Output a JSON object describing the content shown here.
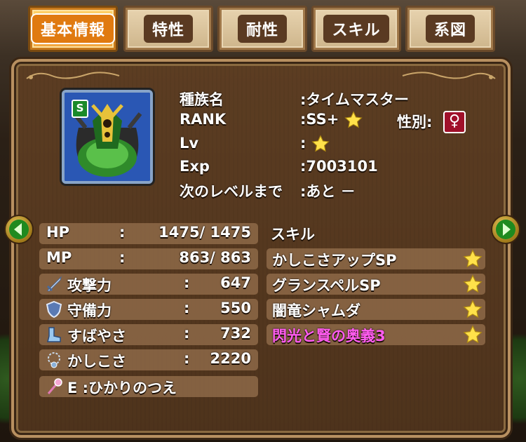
{
  "tabs": [
    {
      "label": "基本情報",
      "active": true
    },
    {
      "label": "特性",
      "active": false
    },
    {
      "label": "耐性",
      "active": false
    },
    {
      "label": "スキル",
      "active": false
    },
    {
      "label": "系図",
      "active": false
    }
  ],
  "monster": {
    "rank_badge": "S",
    "info": [
      {
        "label": "種族名",
        "value": ":タイムマスター"
      },
      {
        "label": "RANK",
        "value": ":SS+"
      },
      {
        "label": "Lv",
        "value": ":"
      },
      {
        "label": "Exp",
        "value": ":7003101"
      },
      {
        "label": "次のレベルまで",
        "value": ":あと －"
      }
    ],
    "gender_label": "性別:",
    "gender_symbol": "♀"
  },
  "stats": [
    {
      "label": "HP",
      "sep": ":",
      "value": "1475/ 1475",
      "icon": "none"
    },
    {
      "label": "MP",
      "sep": ":",
      "value": "863/   863",
      "icon": "none"
    },
    {
      "label": "攻撃力",
      "sep": ":",
      "value": "647",
      "icon": "sword-icon"
    },
    {
      "label": "守備力",
      "sep": ":",
      "value": "550",
      "icon": "shield-icon"
    },
    {
      "label": "すばやさ",
      "sep": ":",
      "value": "732",
      "icon": "boot-icon"
    },
    {
      "label": "かしこさ",
      "sep": ":",
      "value": "2220",
      "icon": "necklace-icon"
    }
  ],
  "equipment": {
    "label": "E :ひかりのつえ",
    "icon": "staff-icon"
  },
  "skills": {
    "title": "スキル",
    "items": [
      {
        "name": "かしこさアップSP",
        "color": "#ffffff"
      },
      {
        "name": "グランスペルSP",
        "color": "#ffffff"
      },
      {
        "name": "闇竜シャムダ",
        "color": "#ffffff"
      },
      {
        "name": "閃光と賢の奥義3",
        "color": "#ff5cf0"
      }
    ]
  },
  "colors": {
    "active_tab": "#f0a23a",
    "star": "#ffe14a",
    "panel": "#4e331c",
    "highlight_skill": "#ff5cf0",
    "gender": "#a0102a"
  }
}
